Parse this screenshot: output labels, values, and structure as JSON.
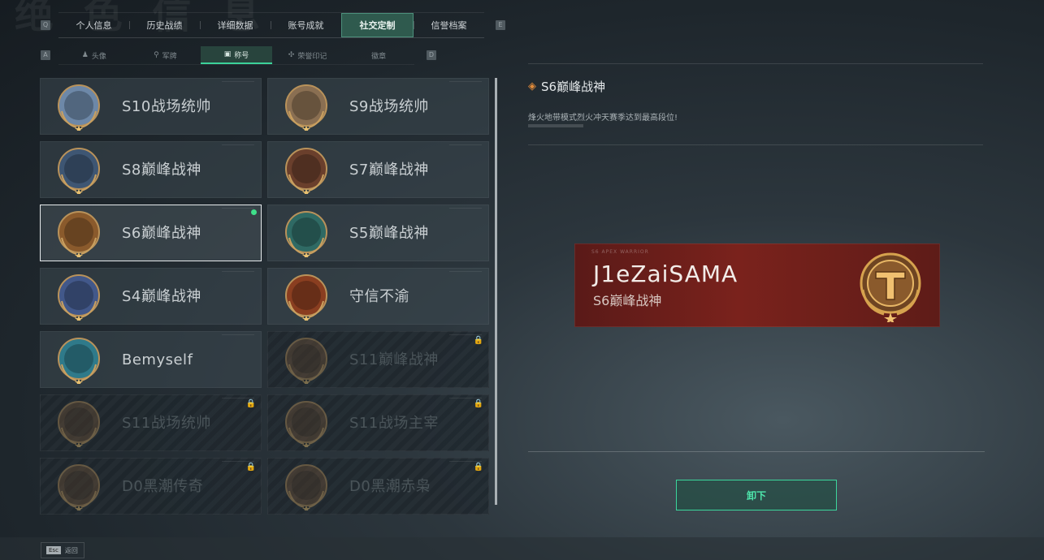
{
  "header": {
    "watermark": "绝 色 信 息"
  },
  "tabs": {
    "prev_key": "Q",
    "next_key": "E",
    "items": [
      {
        "label": "个人信息"
      },
      {
        "label": "历史战绩"
      },
      {
        "label": "详细数据"
      },
      {
        "label": "账号成就"
      },
      {
        "label": "社交定制",
        "active": true
      },
      {
        "label": "信誉档案"
      }
    ]
  },
  "subtabs": {
    "prev_key": "A",
    "next_key": "D",
    "items": [
      {
        "label": "头像",
        "icon": "person-icon"
      },
      {
        "label": "军牌",
        "icon": "dogtag-icon"
      },
      {
        "label": "称号",
        "icon": "title-icon",
        "active": true
      },
      {
        "label": "荣誉印记",
        "icon": "honor-icon"
      },
      {
        "label": "徽章",
        "icon": ""
      }
    ]
  },
  "titles": [
    {
      "name": "S10战场统帅",
      "emblem": "plane-emblem",
      "color": "#6d88a8",
      "locked": false
    },
    {
      "name": "S9战场统帅",
      "emblem": "ship-emblem",
      "color": "#8a6f52",
      "locked": false
    },
    {
      "name": "S8巅峰战神",
      "emblem": "stripes-emblem",
      "color": "#3e5673",
      "locked": false
    },
    {
      "name": "S7巅峰战神",
      "emblem": "gun-emblem",
      "color": "#6a3f2c",
      "locked": false
    },
    {
      "name": "S6巅峰战神",
      "emblem": "t-emblem",
      "color": "#8a5a2c",
      "locked": false,
      "selected": true
    },
    {
      "name": "S5巅峰战神",
      "emblem": "skull-emblem",
      "color": "#2f6a64",
      "locked": false
    },
    {
      "name": "S4巅峰战神",
      "emblem": "helmet-emblem",
      "color": "#42588a",
      "locked": false
    },
    {
      "name": "守信不渝",
      "emblem": "scales-emblem",
      "color": "#8a3e20",
      "locked": false
    },
    {
      "name": "Bemyself",
      "emblem": "soldier-emblem",
      "color": "#2f7a8a",
      "locked": false
    },
    {
      "name": "S11巅峰战神",
      "emblem": "ship2-emblem",
      "color": "#6a5038",
      "locked": true
    },
    {
      "name": "S11战场统帅",
      "emblem": "tank-emblem",
      "color": "#6a5038",
      "locked": true
    },
    {
      "name": "S11战场主宰",
      "emblem": "arch-emblem",
      "color": "#6a5038",
      "locked": true
    },
    {
      "name": "D0黑潮传奇",
      "emblem": "hood-emblem",
      "color": "#6a5038",
      "locked": true
    },
    {
      "name": "D0黑潮赤枭",
      "emblem": "mask-emblem",
      "color": "#6a5038",
      "locked": true
    }
  ],
  "detail": {
    "title": "S6巅峰战神",
    "description": "烽火地带模式烈火冲天赛季达到最高段位!",
    "banner": {
      "small_text": "S6 APEX WARRIOR",
      "player_name": "J1eZaiSAMA",
      "title": "S6巅峰战神"
    },
    "action_label": "卸下"
  },
  "footer": {
    "esc_key": "Esc",
    "esc_label": "返回"
  },
  "colors": {
    "accent": "#3cd69c",
    "active_tab": "#2f5a4e"
  }
}
